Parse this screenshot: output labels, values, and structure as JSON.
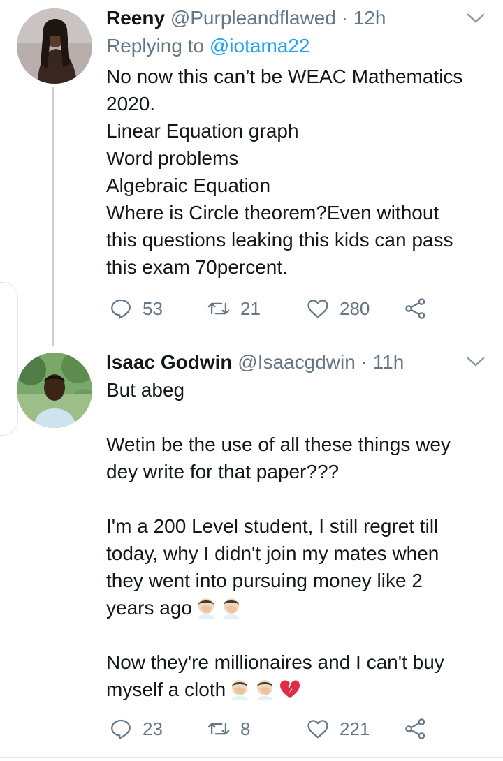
{
  "tweets": [
    {
      "name": "Reeny",
      "handle": "@Purpleandflawed",
      "time": "· 12h",
      "replying_prefix": "Replying to ",
      "replying_to": "@iotama22",
      "text": "No now this can’t be WEAC Mathematics\n2020.\nLinear Equation graph\nWord problems\nAlgebraic Equation\nWhere is Circle theorem?Even without\nthis questions leaking this kids can pass\nthis exam 70percent.",
      "replies": "53",
      "retweets": "21",
      "likes": "280"
    },
    {
      "name": "Isaac Godwin",
      "handle": "@Isaacgdwin",
      "time": "· 11h",
      "text_1": "But abeg\n\nWetin be the use of all these things wey\ndey write for that paper???\n\nI'm a 200 Level student, I still regret till\ntoday, why I didn't join my mates when\nthey went into pursuing money like 2\nyears ago",
      "text_2": "Now they're millionaires and I can't buy\nmyself a cloth",
      "replies": "23",
      "retweets": "8",
      "likes": "221"
    }
  ],
  "icons": {
    "reply": "reply-icon",
    "retweet": "retweet-icon",
    "like": "heart-icon",
    "share": "share-icon",
    "menu": "chevron-down-icon",
    "facepalm": "facepalm-emoji",
    "broken_heart": "broken-heart-emoji"
  },
  "colors": {
    "link": "#1da1f2",
    "secondary": "#657786",
    "thread_line": "#c4cfd6"
  }
}
